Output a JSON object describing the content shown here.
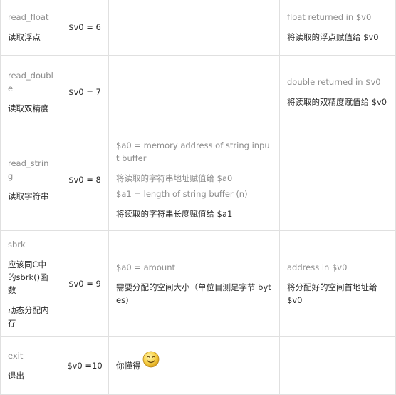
{
  "rows": [
    {
      "name": "read_float",
      "desc_lines": [
        "读取浮点"
      ],
      "code": "$v0 = 6",
      "args": [],
      "result": [
        "float returned in $v0",
        "将读取的浮点赋值给 $v0"
      ]
    },
    {
      "name": "read_double",
      "desc_lines": [
        "读取双精度"
      ],
      "code": "$v0 = 7",
      "args": [],
      "result": [
        "double returned in $v0",
        "将读取的双精度赋值给 $v0"
      ]
    },
    {
      "name": "read_string",
      "desc_lines": [
        "读取字符串"
      ],
      "code": "$v0 = 8",
      "args": [
        "$a0 = memory address of string input buffer",
        "将读取的字符串地址赋值给 $a0",
        "$a1 = length of string buffer (n)",
        "将读取的字符串长度赋值给 $a1"
      ],
      "result": []
    },
    {
      "name": "sbrk",
      "desc_lines": [
        "应该同C中的sbrk()函数",
        "动态分配内存"
      ],
      "code": "$v0 = 9",
      "args": [
        "$a0 = amount",
        "需要分配的空间大小（单位目测是字节 bytes)"
      ],
      "result": [
        "address in $v0",
        "将分配好的空间首地址给 $v0"
      ]
    },
    {
      "name": "exit",
      "desc_lines": [
        "退出"
      ],
      "code": "$v0 =10",
      "args": [
        "你懂得"
      ],
      "result": []
    }
  ],
  "icons": {
    "smiley": "smiley-face-icon"
  }
}
